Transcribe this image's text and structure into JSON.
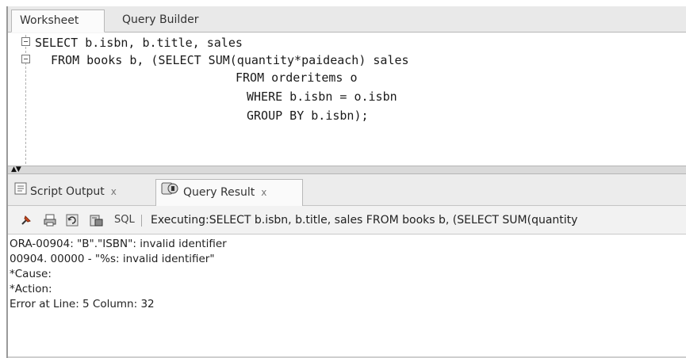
{
  "tabs": {
    "worksheet": "Worksheet",
    "query_builder": "Query Builder"
  },
  "editor": {
    "lines": [
      "SELECT b.isbn, b.title, sales",
      "FROM books b, (SELECT SUM(quantity*paideach) sales",
      "FROM orderitems o",
      "WHERE b.isbn = o.isbn",
      "GROUP BY b.isbn);"
    ]
  },
  "result_tabs": {
    "script_output": "Script Output",
    "query_result": "Query Result",
    "close_glyph": "x"
  },
  "toolbar": {
    "sql_label": "SQL",
    "status": "Executing:SELECT b.isbn, b.title, sales  FROM books b, (SELECT SUM(quantity"
  },
  "output": {
    "lines": [
      "ORA-00904: \"B\".\"ISBN\": invalid identifier",
      "00904. 00000 -  \"%s: invalid identifier\"",
      "*Cause:",
      "*Action:",
      "Error at Line: 5 Column: 32"
    ]
  },
  "colors": {
    "tab_active": "#fbfbfb",
    "panel_bg": "#f4f4f4",
    "pin_icon": "#d14a1e"
  },
  "icons": [
    "fold-minus-icon",
    "script-output-icon",
    "query-result-icon",
    "pin-icon",
    "print-icon",
    "refresh-icon",
    "export-icon"
  ]
}
